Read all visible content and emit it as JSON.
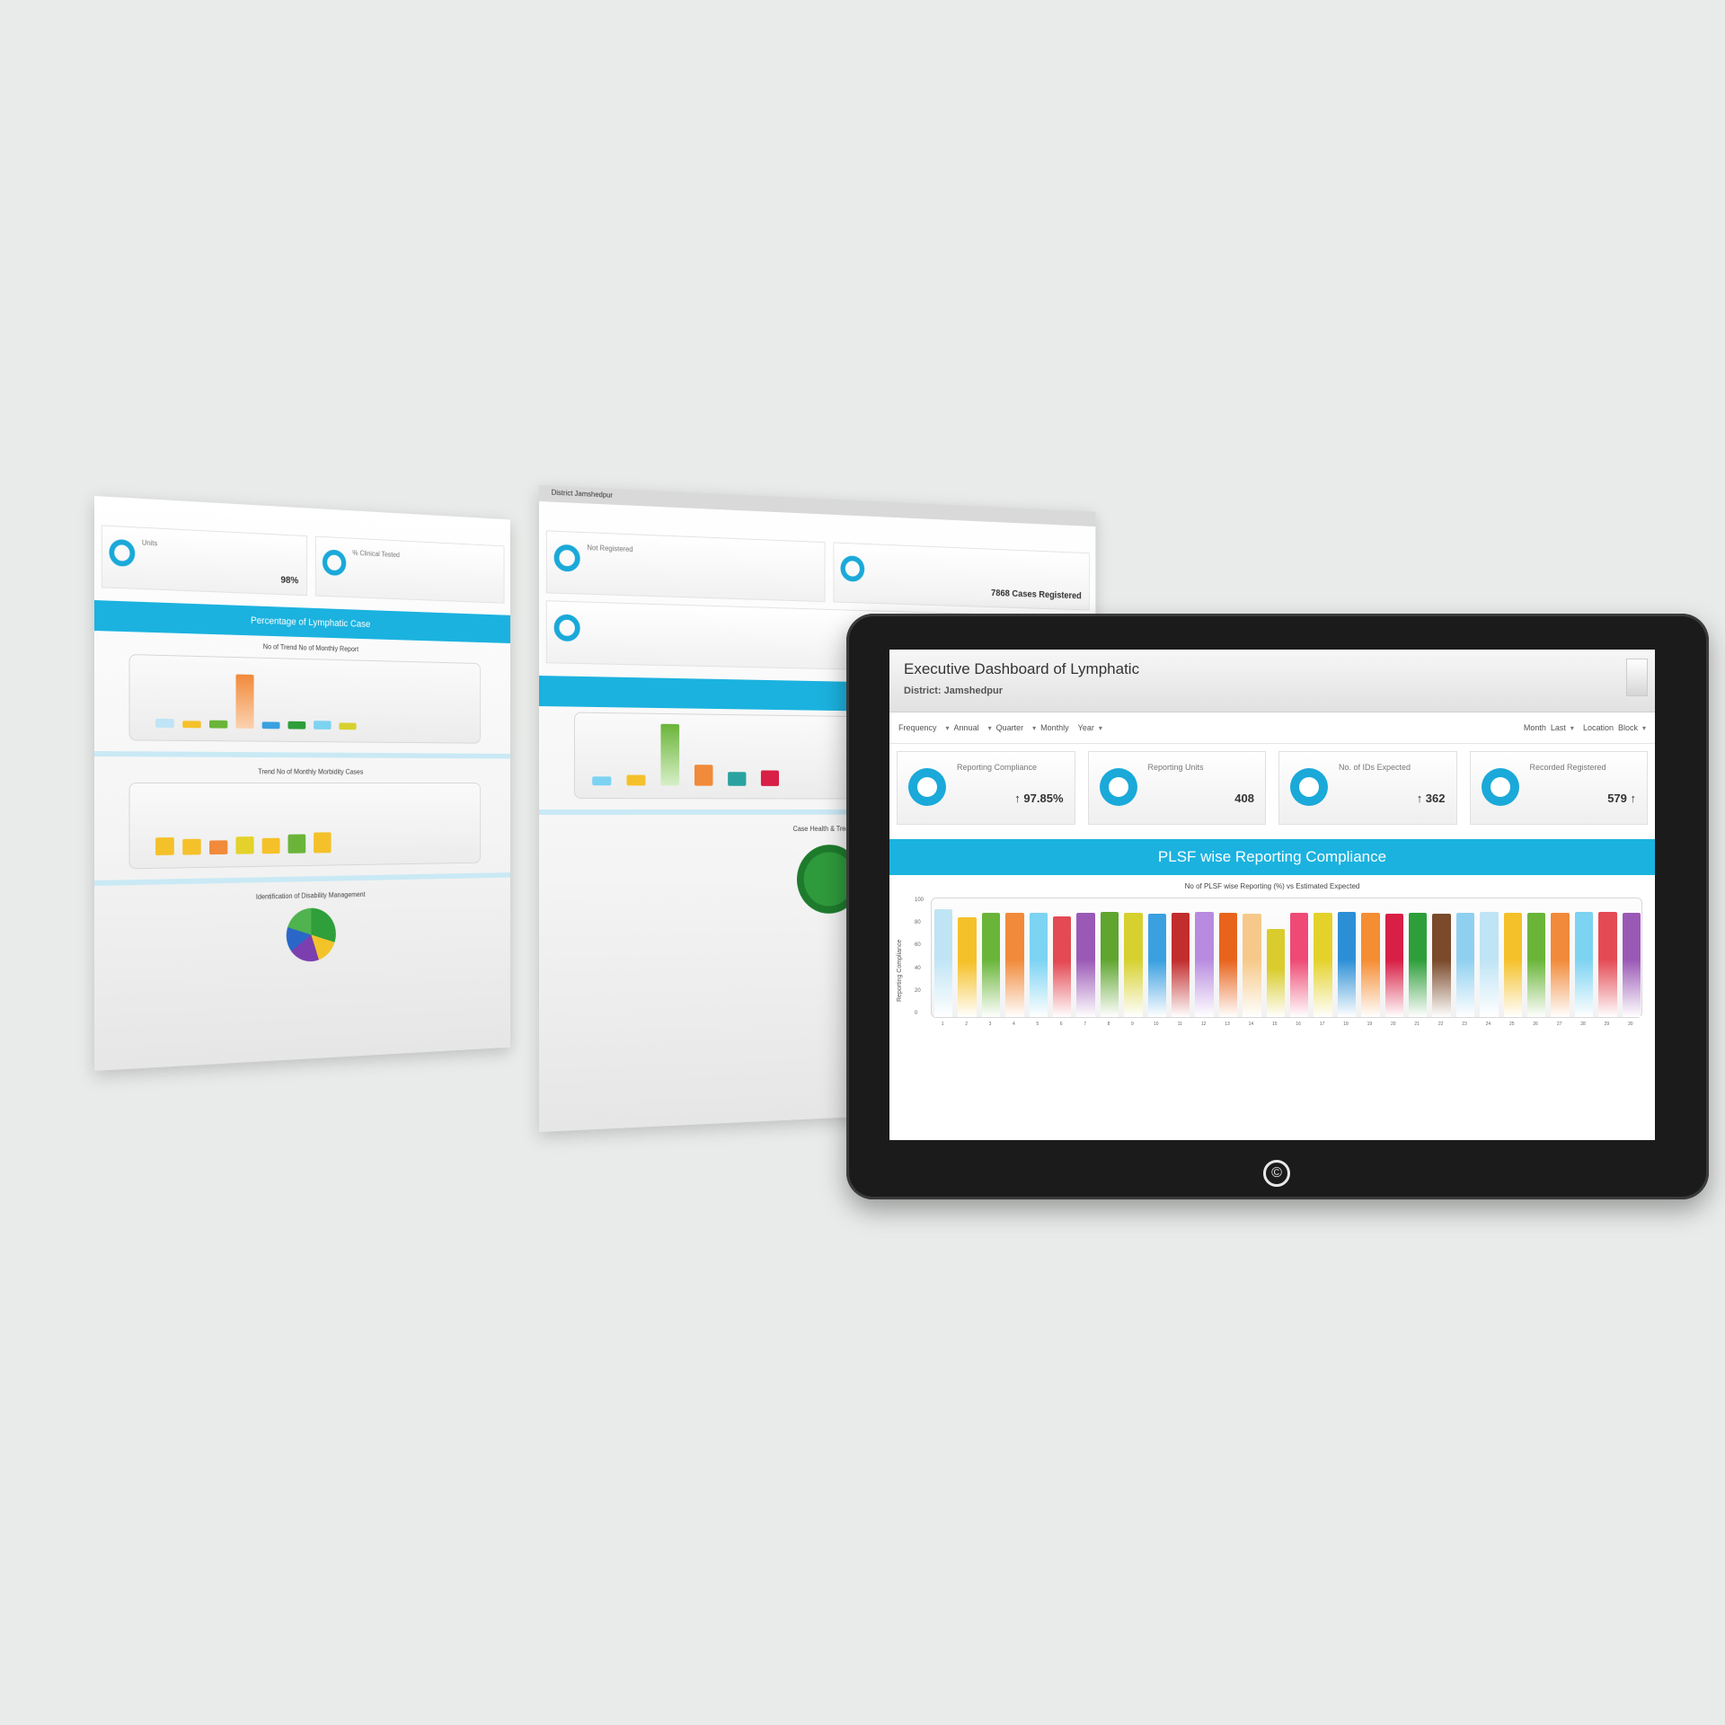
{
  "tablet": {
    "title": "Executive Dashboard of Lymphatic",
    "subtitle": "District: Jamshedpur",
    "filters": [
      "Frequency",
      "Annual",
      "Quarter",
      "Monthly",
      "Year",
      "Month",
      "Last",
      "Location",
      "Block"
    ],
    "kpis": [
      {
        "label": "Reporting Compliance",
        "value": "↑ 97.85%"
      },
      {
        "label": "Reporting Units",
        "value": "408"
      },
      {
        "label": "No. of IDs Expected",
        "value": "↑ 362"
      },
      {
        "label": "Recorded Registered",
        "value": "579 ↑"
      }
    ],
    "band_title": "PLSF wise Reporting Compliance",
    "chart_title": "No of PLSF wise Reporting (%) vs Estimated Expected",
    "y_axis_label": "Reporting Compliance",
    "y_ticks": [
      "100",
      "80",
      "60",
      "40",
      "20",
      "0"
    ],
    "home_symbol": "©"
  },
  "sheet_a": {
    "kpis": [
      {
        "label": "Units",
        "value": "98%"
      },
      {
        "label": "% Clinical Tested",
        "value": ""
      }
    ],
    "band_title": "Percentage of Lymphatic Case",
    "sub1": "No of Trend No of Monthly Report",
    "sub2": "Trend No of Monthly Morbidity Cases",
    "sub3": "Identification of Disability Management"
  },
  "sheet_b": {
    "strip": "District Jamshedpur",
    "kpis": [
      {
        "label": "Not Registered",
        "value": ""
      },
      {
        "label": "7868 Cases Registered",
        "value": "7868"
      }
    ],
    "sub": "Case Health & Treatment"
  },
  "chart_data": {
    "type": "bar",
    "title": "No of PLSF wise Reporting (%) vs Estimated Expected",
    "ylabel": "Reporting Compliance",
    "ylim": [
      0,
      100
    ],
    "categories": [
      "1",
      "2",
      "3",
      "4",
      "5",
      "6",
      "7",
      "8",
      "9",
      "10",
      "11",
      "12",
      "13",
      "14",
      "15",
      "16",
      "17",
      "18",
      "19",
      "20",
      "21",
      "22",
      "23",
      "24",
      "25",
      "26",
      "27",
      "28",
      "29",
      "30"
    ],
    "values": [
      98,
      91,
      95,
      95,
      95,
      92,
      95,
      96,
      95,
      94,
      95,
      96,
      95,
      94,
      80,
      95,
      95,
      96,
      95,
      94,
      95,
      94,
      95,
      96,
      95,
      95,
      95,
      96,
      96,
      95
    ],
    "colors": [
      "#bfe4f5",
      "#f5c12a",
      "#6ab539",
      "#f18a3a",
      "#7cd3f2",
      "#e44a54",
      "#9b59b6",
      "#5fa52f",
      "#d6d12f",
      "#3aa0e0",
      "#c22d2d",
      "#b88be0",
      "#e8641d",
      "#f6c98a",
      "#d9cc2c",
      "#ee4a75",
      "#e4d22b",
      "#2c8fd6",
      "#f58d33",
      "#d81f45",
      "#2e9e3a",
      "#7a4a2a",
      "#8fd0f0",
      "#bfe4f5",
      "#f5c12a",
      "#6ab539",
      "#f18a3a",
      "#7cd3f2",
      "#e44a54",
      "#9b59b6"
    ]
  }
}
